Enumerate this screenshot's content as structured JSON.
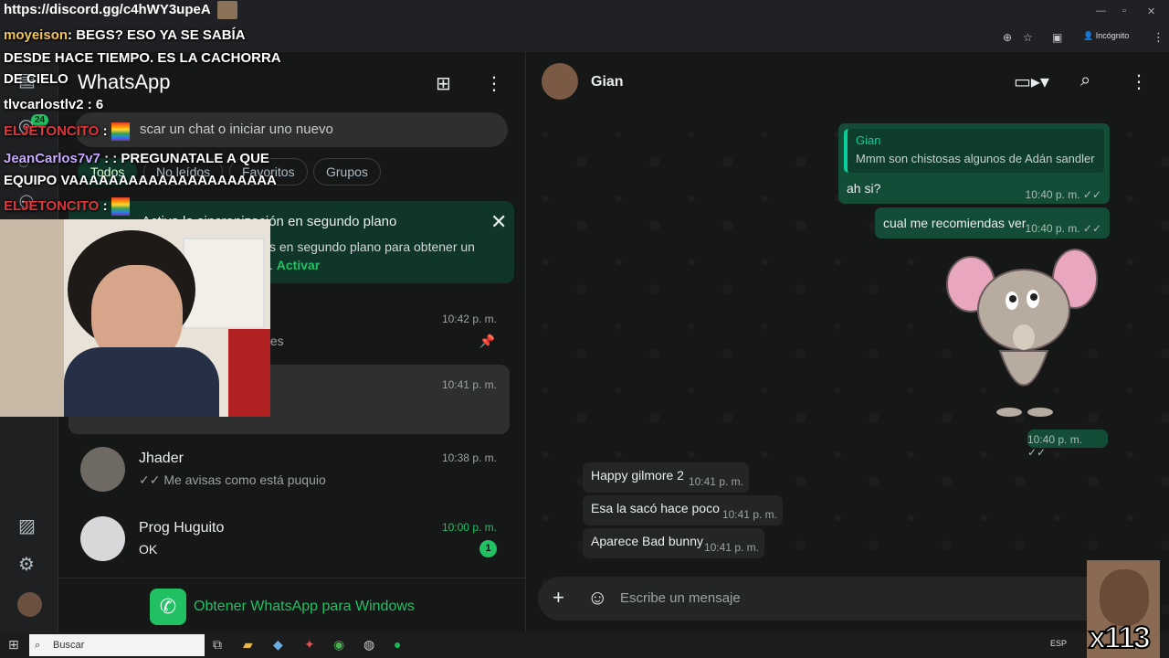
{
  "browser": {
    "url_overlay": "https://discord.gg/c4hWY3upeA",
    "incognito_label": "Incógnito"
  },
  "rail": {
    "unread_badge": "24"
  },
  "sidebar": {
    "title": "WhatsApp",
    "search_placeholder": "scar un chat o iniciar uno nuevo",
    "filters": [
      "Todos",
      "No leídos",
      "Favoritos",
      "Grupos"
    ],
    "banner": {
      "title": "Activa la sincronización en segundo plano",
      "body": "s en segundo plano para obtener un",
      "body2": ". ",
      "action": "Activar"
    },
    "chats": [
      {
        "name": "",
        "preview": "jaes",
        "time": "10:42 p. m.",
        "pinned": true
      },
      {
        "name": "",
        "preview": "",
        "time": "10:41 p. m."
      },
      {
        "name": "Jhader",
        "preview": "✓✓ Me avisas como está puquio",
        "time": "10:38 p. m."
      },
      {
        "name": "Prog Huguito",
        "preview": "OK",
        "time": "10:00 p. m.",
        "unread": "1"
      }
    ],
    "get_app": "Obtener WhatsApp para Windows"
  },
  "chat": {
    "contact": "Gian",
    "messages": [
      {
        "quote_name": "Gian",
        "quote_text": "Mmm son chistosas algunos de Adán sandler",
        "text": "ah si?",
        "time": "10:40 p. m. ✓✓"
      },
      {
        "text": "cual me recomiendas ver",
        "time": "10:40 p. m. ✓✓"
      },
      {
        "sticker_time": "10:40 p. m. ✓✓"
      },
      {
        "text": "Happy gilmore 2",
        "time": "10:41 p. m."
      },
      {
        "text": "Esa la sacó hace poco",
        "time": "10:41 p. m."
      },
      {
        "text": "Aparece Bad bunny",
        "time": "10:41 p. m."
      }
    ],
    "composer_placeholder": "Escribe un mensaje"
  },
  "stream_chat": [
    {
      "user": "moyeison",
      "sep": ": ",
      "text": "BEGS? ESO YA SE SABÍA"
    },
    {
      "text": "DESDE HACE TIEMPO. ES LA CACHORRA"
    },
    {
      "text": "DE CIELO"
    },
    {
      "user": "tlvcarlostlv2",
      "sep": " : ",
      "text": "6"
    },
    {
      "user": "ELJETONCITO",
      "sep": " : "
    },
    {
      "user": "JeanCarlos7v7",
      "sep": " : : ",
      "text": "PREGUNATALE A QUE"
    },
    {
      "text": "EQUIPO VAAAAAAAAAAAAAAAAAAAAA"
    },
    {
      "user": "ELJETONCITO",
      "sep": " : "
    }
  ],
  "taskbar": {
    "search": "Buscar",
    "tray": "ESP"
  },
  "meme_counter": "x113"
}
